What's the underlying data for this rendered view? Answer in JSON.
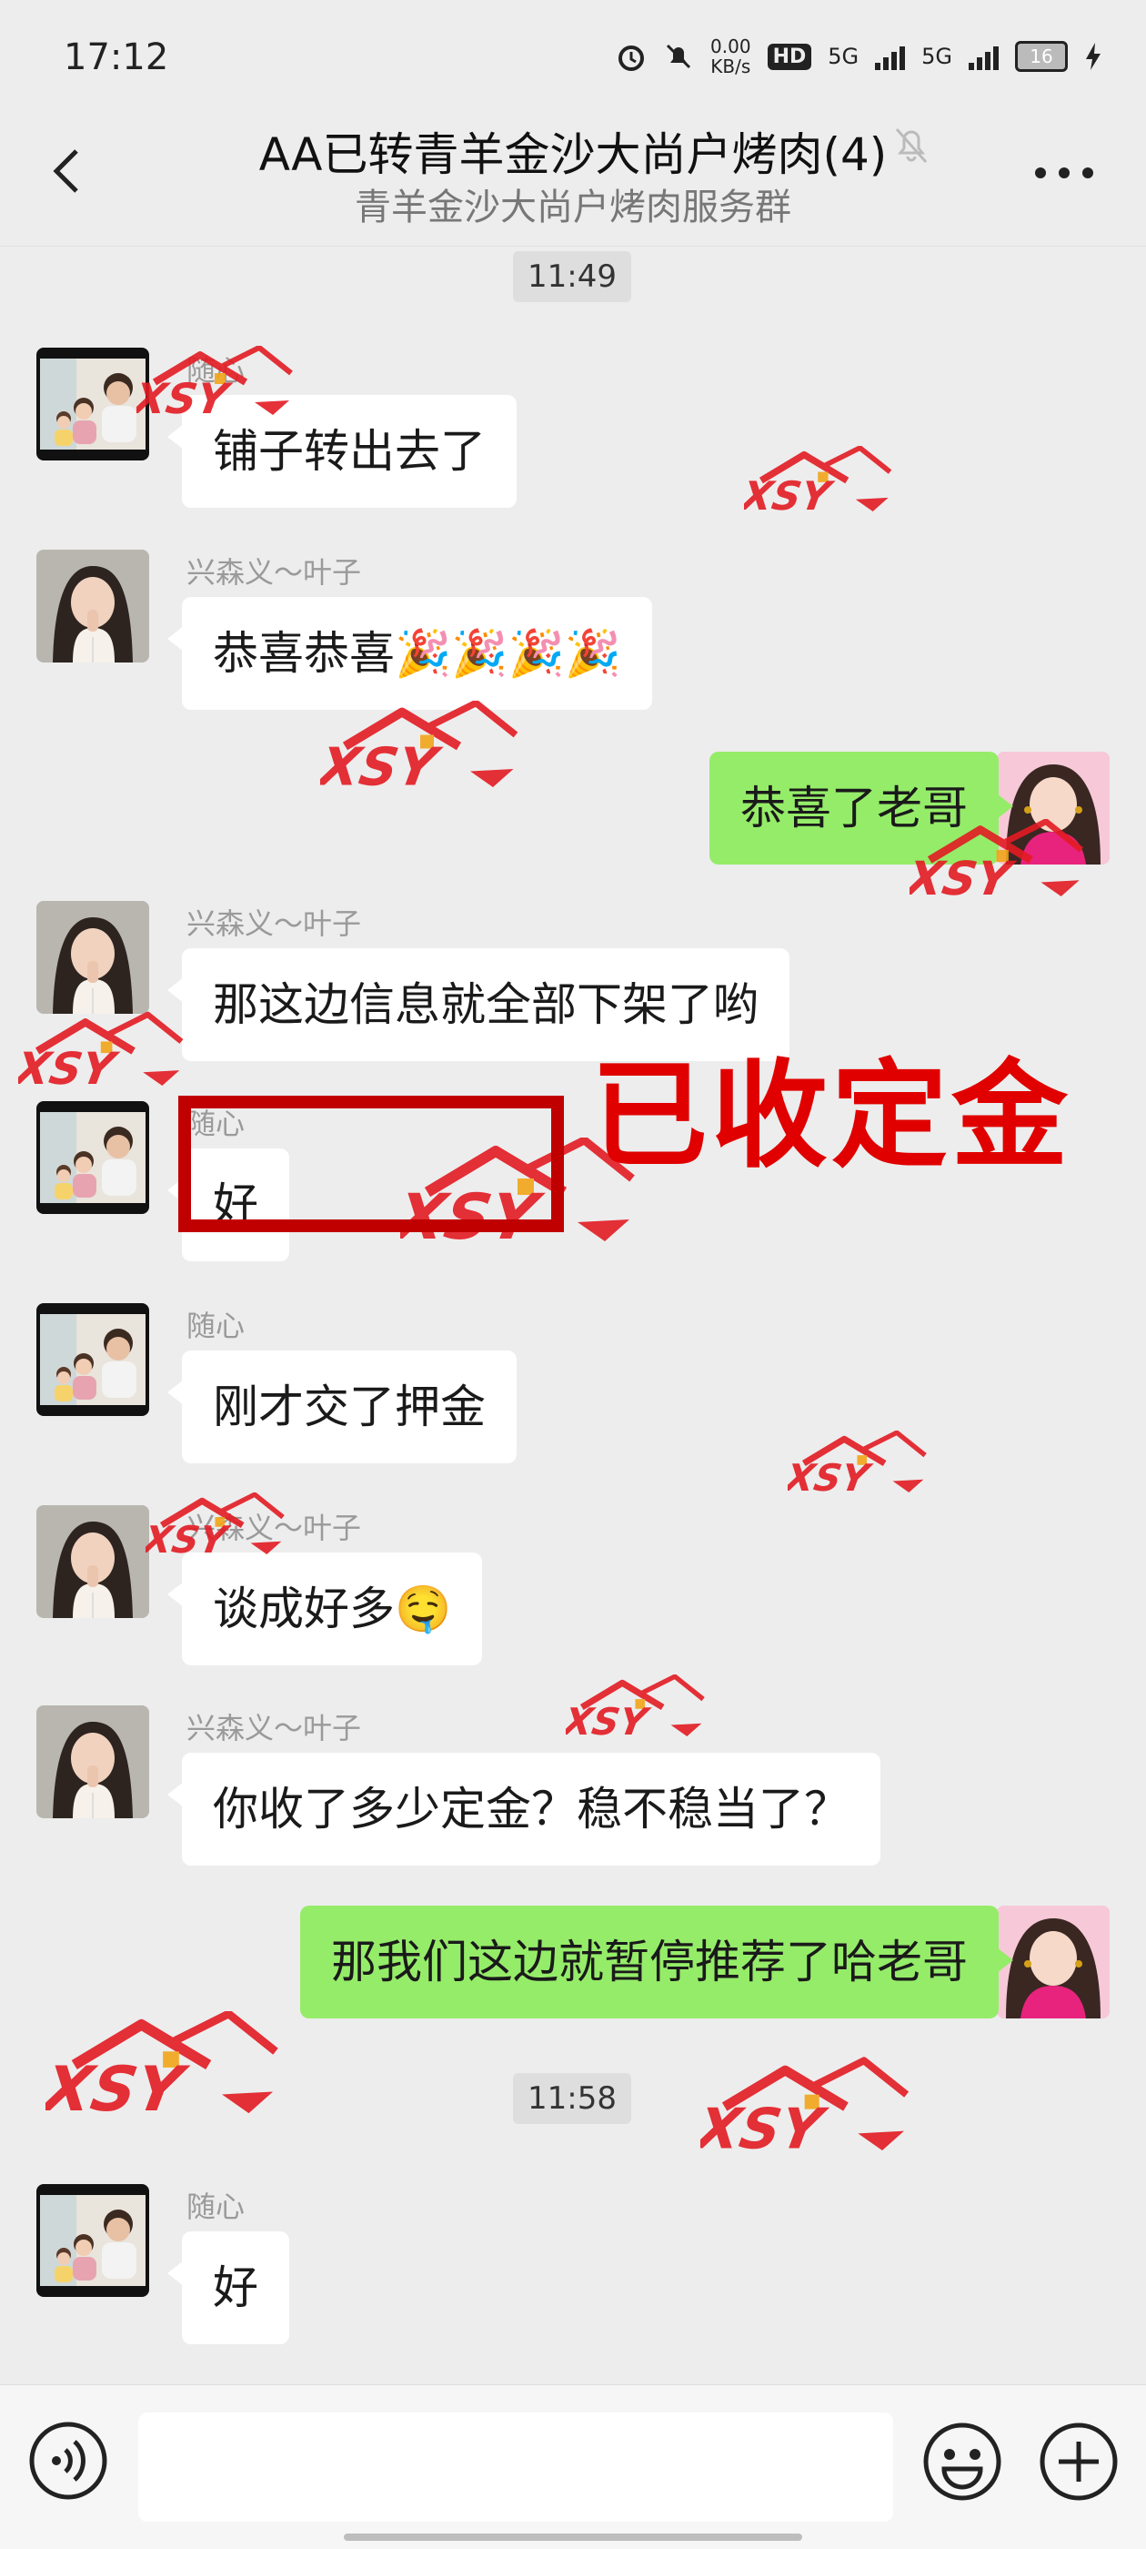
{
  "status": {
    "time": "17:12",
    "net_speed_value": "0.00",
    "net_speed_unit": "KB/s",
    "hd_label": "HD",
    "sim1": "5G",
    "sim2": "5G",
    "battery": "16"
  },
  "header": {
    "title": "AA已转青羊金沙大尚户烤肉(4)",
    "subtitle": "青羊金沙大尚户烤肉服务群"
  },
  "messages": {
    "t1": "11:49",
    "m1": {
      "sender": "随心",
      "text": "铺子转出去了"
    },
    "m2": {
      "sender": "兴森义～叶子",
      "text": "恭喜恭喜🎉🎉🎉🎉"
    },
    "m3": {
      "text": "恭喜了老哥"
    },
    "m4": {
      "sender": "兴森义～叶子",
      "text": "那这边信息就全部下架了哟"
    },
    "m5": {
      "sender": "随心",
      "text": "好"
    },
    "m6": {
      "sender": "随心",
      "text": "刚才交了押金"
    },
    "m7": {
      "sender": "兴森义～叶子",
      "text": "谈成好多🤤"
    },
    "m8": {
      "sender": "兴森义～叶子",
      "text": "你收了多少定金？稳不稳当了？"
    },
    "m9": {
      "text": "那我们这边就暂停推荐了哈老哥"
    },
    "t2": "11:58",
    "m10": {
      "sender": "随心",
      "text": "好"
    }
  },
  "annotation": {
    "stamp": "已收定金"
  },
  "watermark_text": "XSY",
  "colors": {
    "bubble_self": "#95ec69",
    "bubble_other": "#ffffff",
    "background": "#ededed",
    "annotation_red": "#e00000"
  }
}
